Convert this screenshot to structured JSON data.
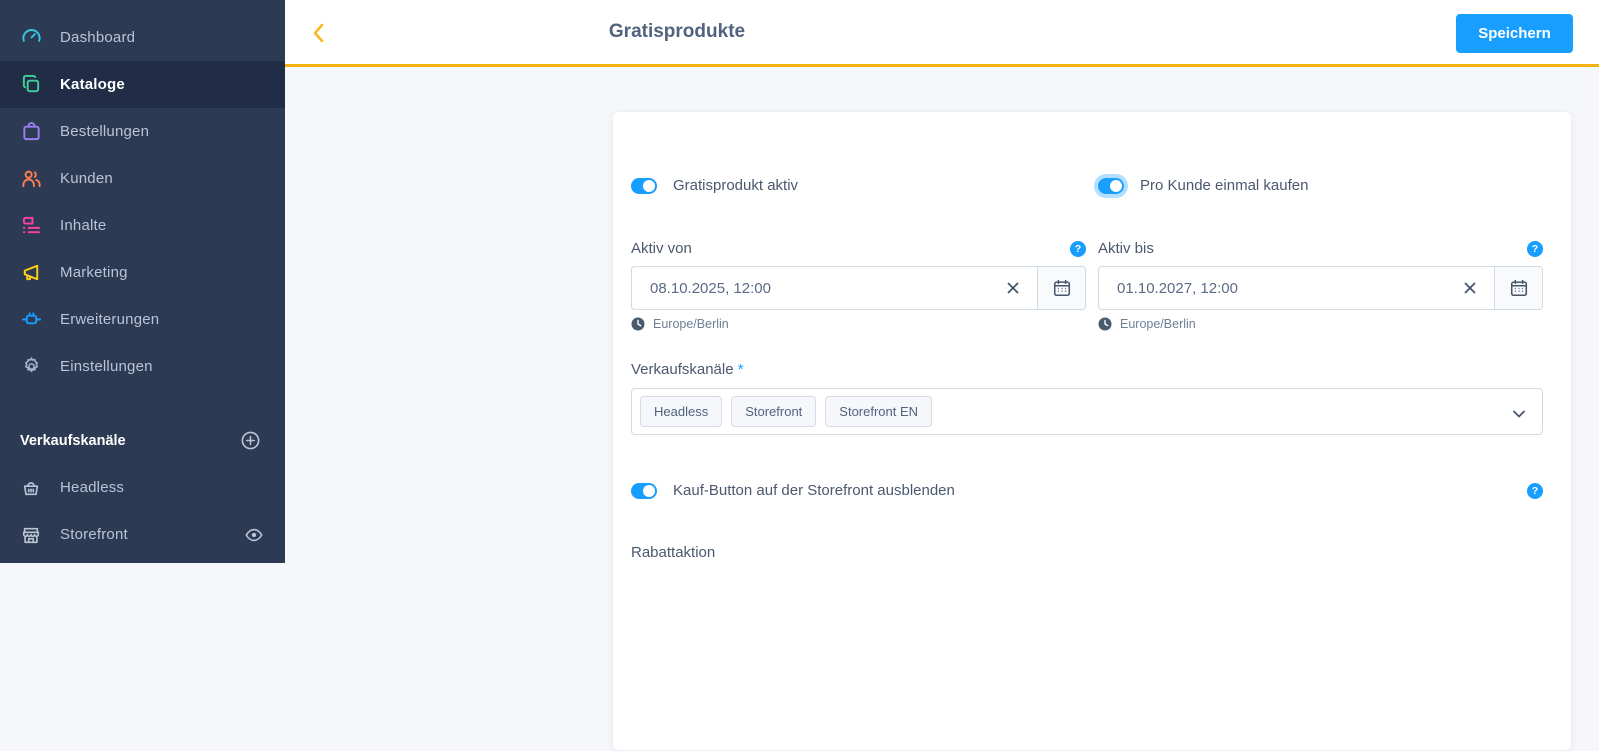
{
  "colors": {
    "sidebar_bg": "#2d3a53",
    "sidebar_active_bg": "#212d47",
    "accent_blue": "#189eff",
    "module_amber": "#f5b312",
    "icon_dashboard": "#35c7e8",
    "icon_catalog": "#43cf9c",
    "icon_orders": "#9d7ef5",
    "icon_customers": "#ff7d52",
    "icon_content": "#ff3ea5",
    "icon_marketing": "#ffd013",
    "icon_extensions": "#189eff",
    "icon_settings": "#a9b4c7"
  },
  "sidebar": {
    "items": [
      {
        "label": "Dashboard"
      },
      {
        "label": "Kataloge"
      },
      {
        "label": "Bestellungen"
      },
      {
        "label": "Kunden"
      },
      {
        "label": "Inhalte"
      },
      {
        "label": "Marketing"
      },
      {
        "label": "Erweiterungen"
      },
      {
        "label": "Einstellungen"
      }
    ],
    "section_label": "Verkaufskanäle",
    "channels": [
      {
        "label": "Headless"
      },
      {
        "label": "Storefront"
      }
    ]
  },
  "header": {
    "title": "Gratisprodukte",
    "save_label": "Speichern"
  },
  "glyphs": {
    "help": "?"
  },
  "form": {
    "toggle_active": {
      "label": "Gratisprodukt aktiv",
      "state": "on"
    },
    "toggle_once": {
      "label": "Pro Kunde einmal kaufen",
      "state": "on"
    },
    "active_from": {
      "label": "Aktiv von",
      "value": "08.10.2025, 12:00",
      "timezone": "Europe/Berlin"
    },
    "active_until": {
      "label": "Aktiv bis",
      "value": "01.10.2027, 12:00",
      "timezone": "Europe/Berlin"
    },
    "sales_channels": {
      "label": "Verkaufskanäle",
      "required_mark": "*",
      "tags": [
        "Headless",
        "Storefront",
        "Storefront EN"
      ]
    },
    "toggle_hide_buy": {
      "label": "Kauf-Button auf der Storefront ausblenden",
      "state": "on"
    },
    "discount_section_label": "Rabattaktion"
  }
}
